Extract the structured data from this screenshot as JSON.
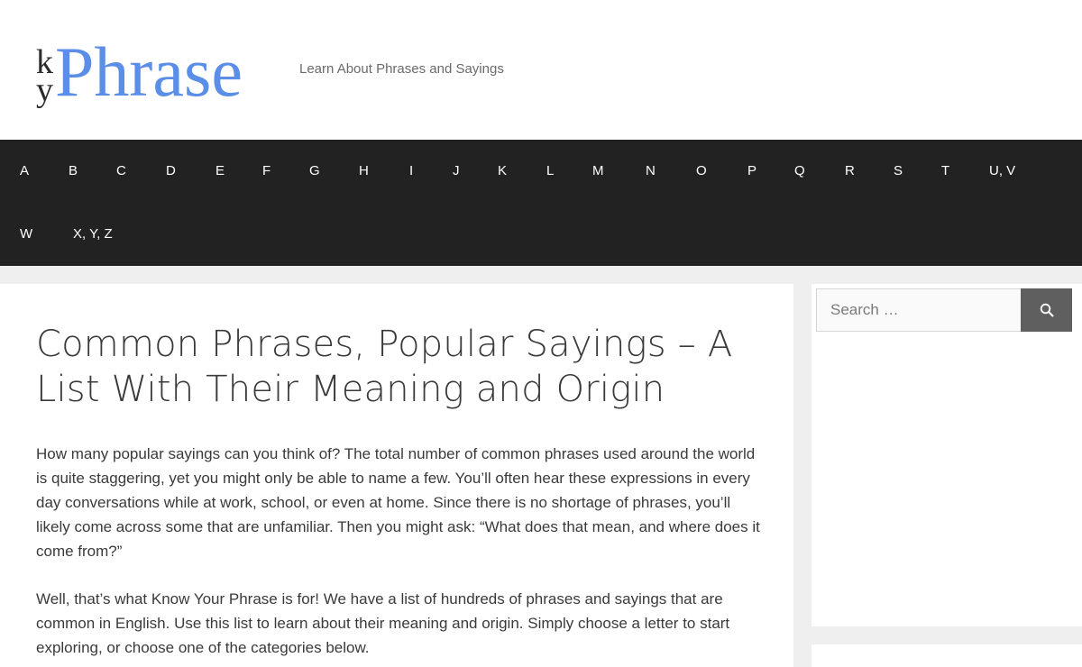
{
  "header": {
    "logo": {
      "ky_top": "k",
      "ky_bottom": "y",
      "main": "Phrase"
    },
    "tagline": "Learn About Phrases and Sayings"
  },
  "nav": {
    "items": [
      "A",
      "B",
      "C",
      "D",
      "E",
      "F",
      "G",
      "H",
      "I",
      "J",
      "K",
      "L",
      "M",
      "N",
      "O",
      "P",
      "Q",
      "R",
      "S",
      "T",
      "U, V",
      "W",
      "X, Y, Z"
    ]
  },
  "main": {
    "title": "Common Phrases, Popular Sayings – A List With Their Meaning and Origin",
    "paragraphs": [
      "How many popular sayings can you think of? The total number of common phrases used around the world is quite staggering, yet you might only be able to name a few. You’ll often hear these expressions in every day conversations while at work, school, or even at home. Since there is no shortage of phrases, you’ll likely come across some that are unfamiliar. Then you might ask: “What does that mean, and where does it come from?”",
      "Well, that’s what Know Your Phrase is for! We have a list of hundreds of phrases and sayings that are common in English. Use this list to learn about their meaning and origin. Simply choose a letter to start exploring, or choose one of the categories below."
    ]
  },
  "sidebar": {
    "search": {
      "placeholder": "Search …",
      "button_icon": "search-icon"
    }
  },
  "colors": {
    "brand_blue": "#5b8ee6",
    "nav_bg": "#222222",
    "search_button": "#5f5f5f"
  }
}
